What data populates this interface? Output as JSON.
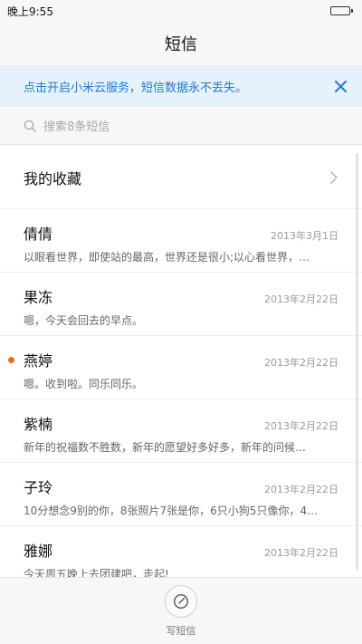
{
  "status_bar": {
    "time": "晚上9:55"
  },
  "header": {
    "title": "短信"
  },
  "banner": {
    "text": "点击开启小米云服务，短信数据永不丢失。"
  },
  "search": {
    "placeholder": "搜索8条短信"
  },
  "favorites": {
    "label": "我的收藏"
  },
  "conversations": [
    {
      "name": "倩倩",
      "date": "2013年3月1日",
      "preview": "以眼看世界，即使站的最高，世界还是很小;以心看世界，…",
      "unread": false
    },
    {
      "name": "果冻",
      "date": "2013年2月22日",
      "preview": "嗯，今天会回去的早点。",
      "unread": false
    },
    {
      "name": "燕婷",
      "date": "2013年2月22日",
      "preview": "嗯。收到啦。同乐同乐。",
      "unread": true
    },
    {
      "name": "紫楠",
      "date": "2013年2月22日",
      "preview": "新年的祝福数不胜数，新年的愿望好多好多，新年的问候…",
      "unread": false
    },
    {
      "name": "子玲",
      "date": "2013年2月22日",
      "preview": "10分想念9别的你，8张照片7张是你，6只小狗5只像你，4…",
      "unread": false
    },
    {
      "name": "雅娜",
      "date": "2013年2月22日",
      "preview": "今天周五晚上去团建吧，走起!",
      "unread": false
    }
  ],
  "bottom": {
    "compose_label": "写短信"
  },
  "colors": {
    "accent": "#1f7ad6",
    "unread_dot": "#f26a21",
    "banner_bg": "#e6f1fb"
  },
  "icons": {
    "search": "search-icon",
    "close": "close-icon",
    "chevron": "chevron-right-icon",
    "compose": "compose-icon",
    "battery": "battery-icon"
  }
}
